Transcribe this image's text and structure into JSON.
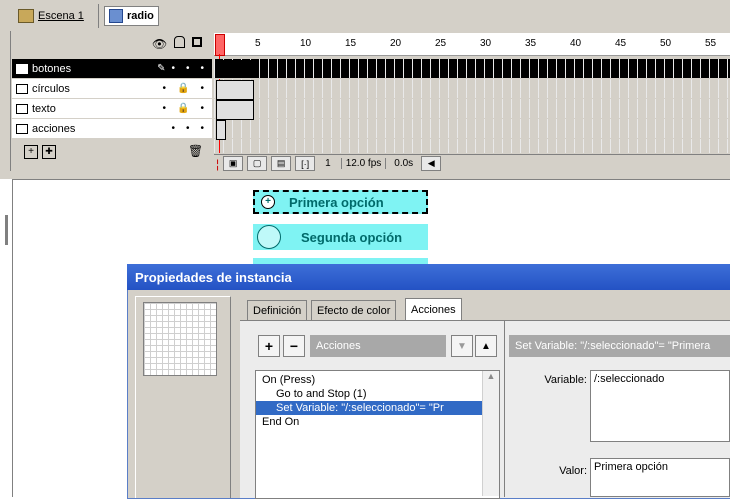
{
  "breadcrumb": {
    "scene": "Escena 1",
    "symbol": "radio"
  },
  "timeline": {
    "ticks": [
      "5",
      "10",
      "15",
      "20",
      "25",
      "30",
      "35",
      "40",
      "45",
      "50",
      "55"
    ],
    "layers": [
      {
        "name": "botones",
        "selected": true
      },
      {
        "name": "círculos",
        "selected": false
      },
      {
        "name": "texto",
        "selected": false
      },
      {
        "name": "acciones",
        "selected": false
      }
    ],
    "status": {
      "frame": "1",
      "fps": "12.0 fps",
      "time": "0.0s"
    }
  },
  "stage": {
    "option1": "Primera opción",
    "option2": "Segunda opción"
  },
  "dialog": {
    "title": "Propiedades de instancia",
    "tabs": [
      "Definición",
      "Efecto de color",
      "Acciones"
    ],
    "active_tab": "Acciones",
    "actions_select": "Acciones",
    "commands": [
      {
        "text": "On (Press)",
        "indent": 0,
        "selected": false
      },
      {
        "text": "Go to and Stop (1)",
        "indent": 1,
        "selected": false
      },
      {
        "text": "Set Variable: \"/:seleccionado\"= \"Pr",
        "indent": 1,
        "selected": true
      },
      {
        "text": "End On",
        "indent": 0,
        "selected": false
      }
    ],
    "set_header": "Set Variable: \"/:seleccionado\"= \"Primera",
    "variable_label": "Variable:",
    "variable_value": "/:seleccionado",
    "value_label": "Valor:",
    "value_value": "Primera opción"
  },
  "colors": {
    "accent": "#316ac5",
    "radio_fill": "#7ff3f3",
    "titlebar": "#2452c4"
  }
}
